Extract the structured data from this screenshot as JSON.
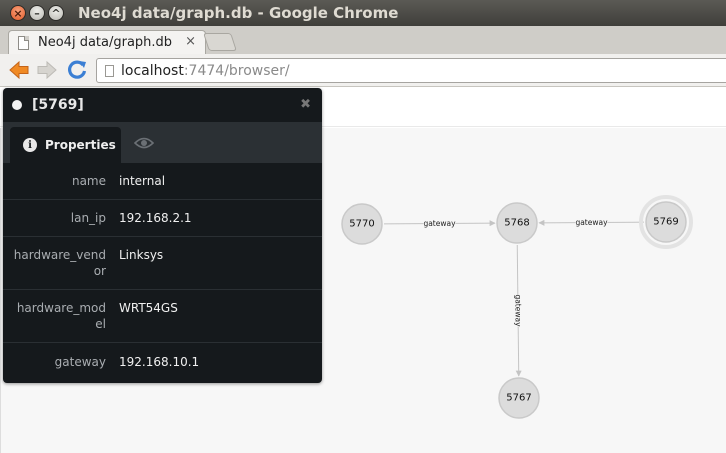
{
  "window": {
    "title": "Neo4j data/graph.db - Google Chrome",
    "controls": [
      "close-icon",
      "minimize-icon",
      "maximize-icon"
    ]
  },
  "tab": {
    "title": "Neo4j data/graph.db",
    "close_glyph": "×"
  },
  "omnibox": {
    "host": "localhost",
    "path": ":7474/browser/"
  },
  "inspector": {
    "title": "[5769]",
    "close_glyph": "✖",
    "tab_properties_label": "Properties",
    "properties": [
      {
        "key": "name",
        "value": "internal"
      },
      {
        "key": "lan_ip",
        "value": "192.168.2.1"
      },
      {
        "key": "hardware_vendor",
        "key_lines": [
          "hardware_vend",
          "or"
        ],
        "value": "Linksys"
      },
      {
        "key": "hardware_model",
        "key_lines": [
          "hardware_mod",
          "el"
        ],
        "value": "WRT54GS"
      },
      {
        "key": "gateway",
        "value": "192.168.10.1"
      }
    ]
  },
  "graph": {
    "nodes": [
      {
        "id": "5770",
        "label": "5770",
        "selected": false
      },
      {
        "id": "5768",
        "label": "5768",
        "selected": false
      },
      {
        "id": "5769",
        "label": "5769",
        "selected": true
      },
      {
        "id": "5767",
        "label": "5767",
        "selected": false
      }
    ],
    "relationships": [
      {
        "from": "5770",
        "to": "5768",
        "type": "gateway"
      },
      {
        "from": "5769",
        "to": "5768",
        "type": "gateway"
      },
      {
        "from": "5768",
        "to": "5767",
        "type": "gateway"
      }
    ]
  },
  "colors": {
    "node_fill": "#dcdcdc",
    "node_stroke": "#c9c9c9",
    "edge": "#c4c4c4",
    "panel_bg": "#15191c"
  }
}
